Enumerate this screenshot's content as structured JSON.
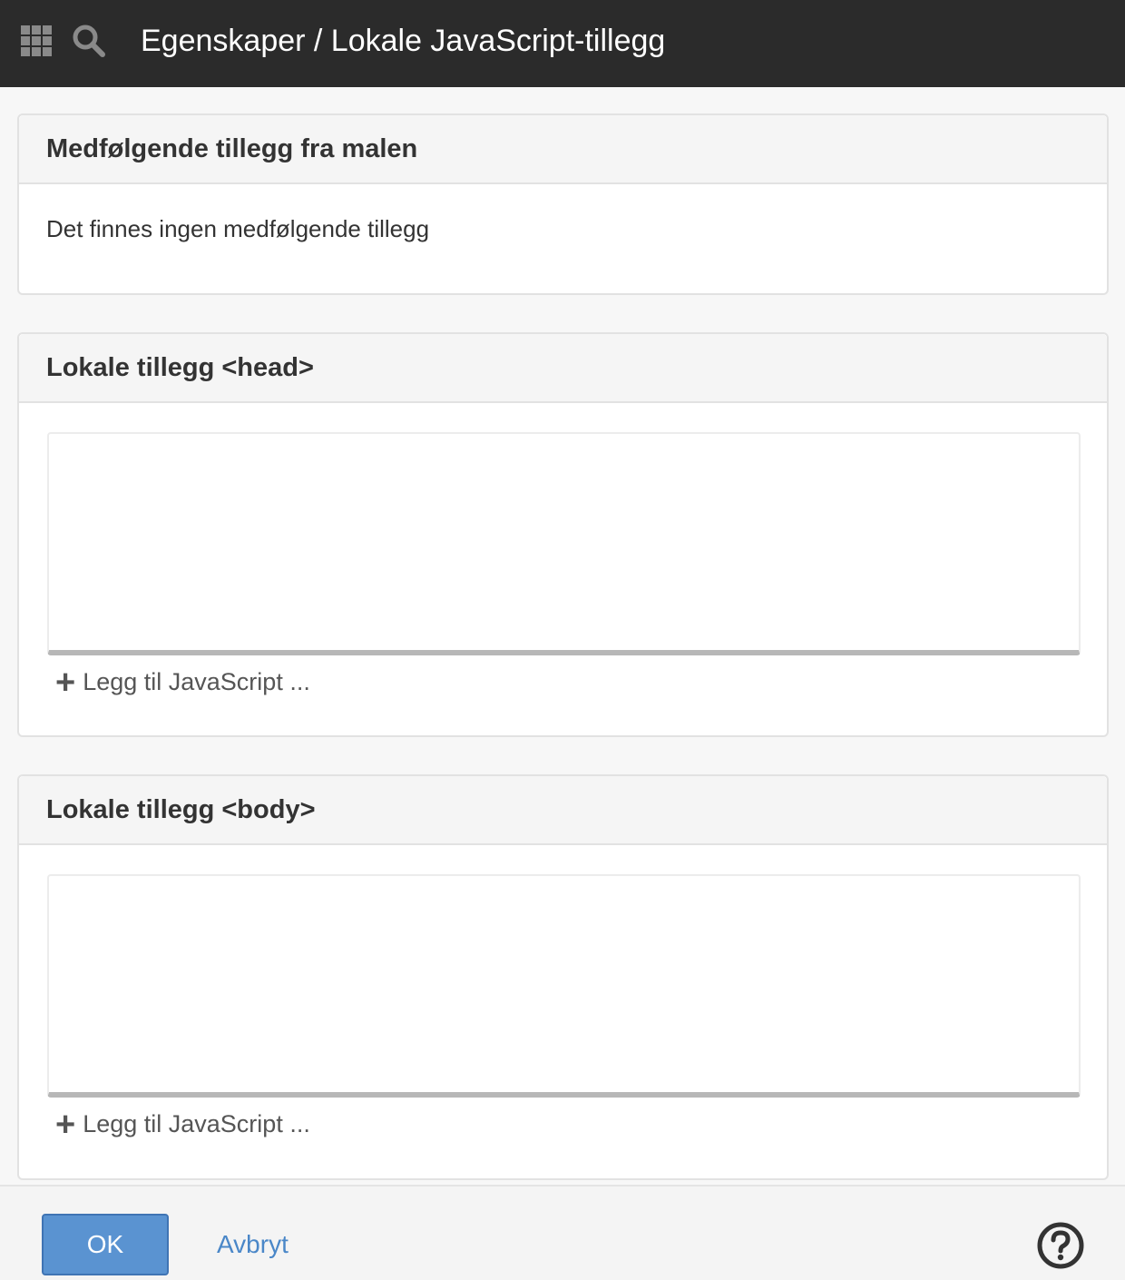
{
  "header": {
    "title": "Egenskaper / Lokale JavaScript-tillegg",
    "apps_icon": "grid-icon",
    "search_icon": "search-icon"
  },
  "panels": {
    "template_addons": {
      "title": "Medfølgende tillegg fra malen",
      "empty_text": "Det finnes ingen medfølgende tillegg"
    },
    "head_addons": {
      "title": "Lokale tillegg <head>",
      "add_label": "Legg til JavaScript ..."
    },
    "body_addons": {
      "title": "Lokale tillegg <body>",
      "add_label": "Legg til JavaScript ..."
    }
  },
  "footer": {
    "ok_label": "OK",
    "cancel_label": "Avbryt",
    "help_icon": "help-icon"
  },
  "colors": {
    "topbar": "#2b2b2b",
    "primary": "#5a93d1",
    "link": "#4a87c8"
  }
}
